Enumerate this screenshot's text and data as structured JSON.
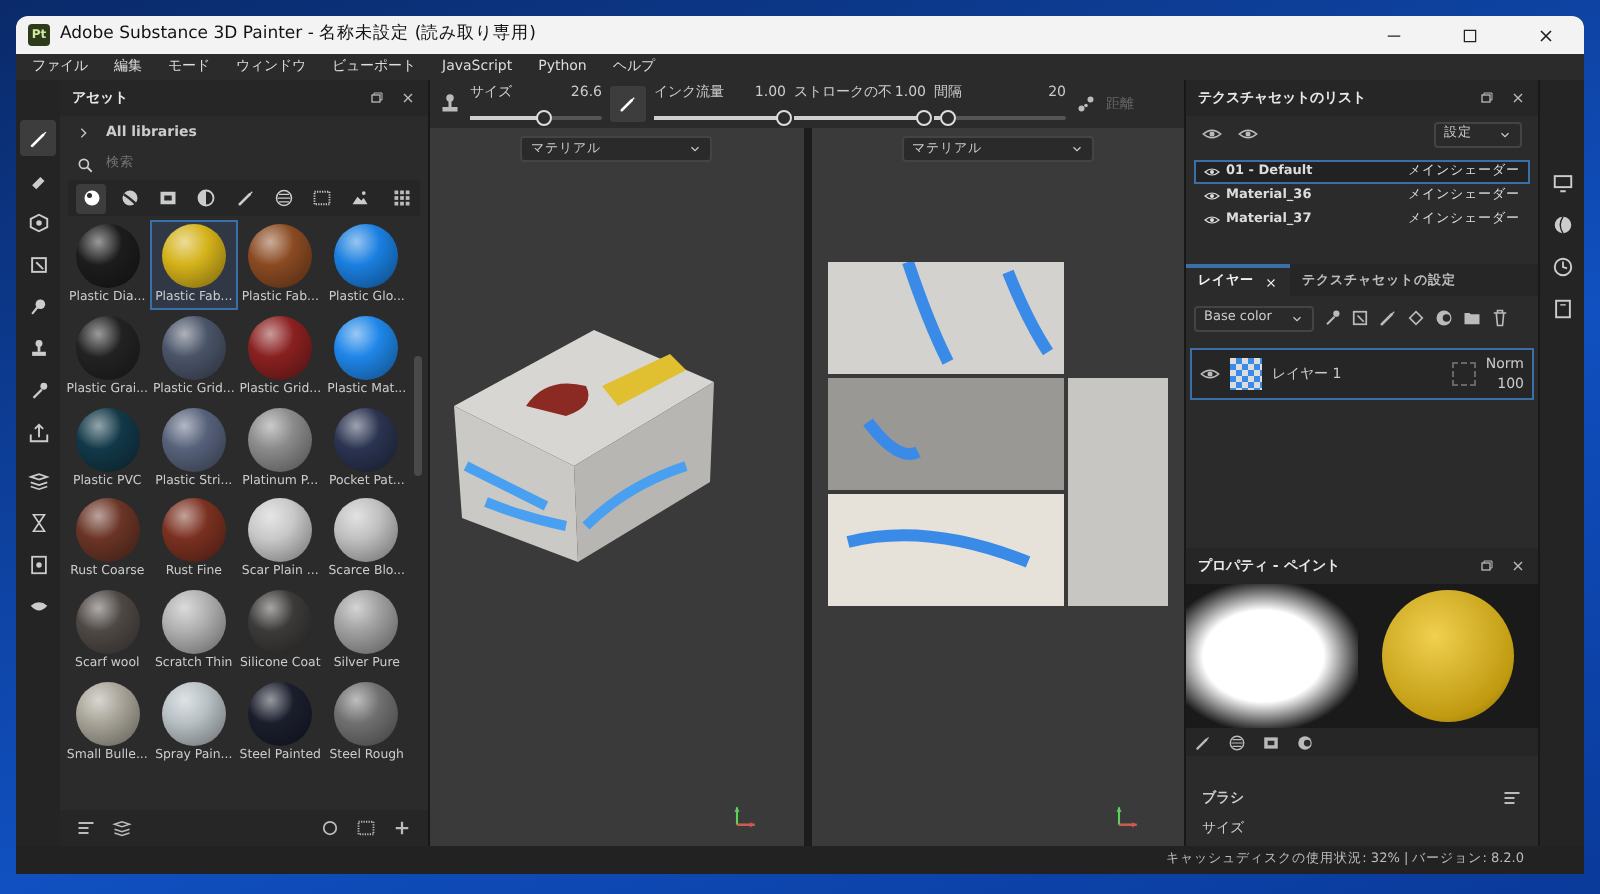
{
  "window": {
    "title": "Adobe Substance 3D Painter - 名称未設定 (読み取り専用)",
    "app_icon": "Pt"
  },
  "menu": [
    "ファイル",
    "編集",
    "モード",
    "ウィンドウ",
    "ビューポート",
    "JavaScript",
    "Python",
    "ヘルプ"
  ],
  "tools": [
    {
      "selected": true
    },
    {
      "selected": false
    },
    {
      "selected": false
    },
    {
      "selected": false
    },
    {
      "selected": false
    },
    {
      "selected": false
    },
    {
      "selected": false
    },
    {
      "selected": false
    },
    {
      "selected": false
    },
    {
      "selected": false
    },
    {
      "selected": false
    },
    {
      "selected": false
    }
  ],
  "assets": {
    "title": "アセット",
    "library": "All libraries",
    "search": {
      "placeholder": "検索"
    },
    "filters": [
      {
        "selected": true
      },
      {
        "selected": false
      },
      {
        "selected": false
      },
      {
        "selected": false
      },
      {
        "selected": false
      },
      {
        "selected": false
      },
      {
        "selected": false
      },
      {
        "selected": false
      }
    ],
    "materials": [
      {
        "label": "Plastic Dia...",
        "color": "#1c1c1c",
        "selected": false
      },
      {
        "label": "Plastic Fab...",
        "color": "#d4b21a",
        "selected": true
      },
      {
        "label": "Plastic Fab...",
        "color": "#8a4a22",
        "selected": false
      },
      {
        "label": "Plastic Glo...",
        "color": "#1a7fe0",
        "selected": false
      },
      {
        "label": "Plastic Grai...",
        "color": "#222222",
        "selected": false
      },
      {
        "label": "Plastic Grid...",
        "color": "#4a5468",
        "selected": false
      },
      {
        "label": "Plastic Grid...",
        "color": "#8a2020",
        "selected": false
      },
      {
        "label": "Plastic Mat...",
        "color": "#1e86e8",
        "selected": false
      },
      {
        "label": "Plastic PVC",
        "color": "#123848",
        "selected": false
      },
      {
        "label": "Plastic Stri...",
        "color": "#56617a",
        "selected": false
      },
      {
        "label": "Platinum P...",
        "color": "#8a8a8a",
        "selected": false
      },
      {
        "label": "Pocket Pat...",
        "color": "#2a3350",
        "selected": false
      },
      {
        "label": "Rust Coarse",
        "color": "#6a3426",
        "selected": false
      },
      {
        "label": "Rust Fine",
        "color": "#7a3020",
        "selected": false
      },
      {
        "label": "Scar Plain ...",
        "color": "#c8c8c8",
        "selected": false
      },
      {
        "label": "Scarce Blo...",
        "color": "#c0c0c0",
        "selected": false
      },
      {
        "label": "Scarf wool",
        "color": "#4e4844",
        "selected": false
      },
      {
        "label": "Scratch Thin",
        "color": "#b0b0b0",
        "selected": false
      },
      {
        "label": "Silicone Coat",
        "color": "#3c3a38",
        "selected": false
      },
      {
        "label": "Silver Pure",
        "color": "#a0a0a0",
        "selected": false
      },
      {
        "label": "Small Bulle...",
        "color": "#a8a498",
        "selected": false
      },
      {
        "label": "Spray Pain...",
        "color": "#b8c0c4",
        "selected": false
      },
      {
        "label": "Steel Painted",
        "color": "#1a1e2c",
        "selected": false
      },
      {
        "label": "Steel Rough",
        "color": "#707070",
        "selected": false
      }
    ]
  },
  "toolbar": {
    "sliders": [
      {
        "label": "サイズ",
        "reading": "26.6",
        "level": 0.55
      },
      {
        "label": "インク流量",
        "reading": "1.00",
        "level": 1
      },
      {
        "label": "ストロークの不",
        "reading": "1.00",
        "level": 1
      },
      {
        "label": "間隔",
        "reading": "20",
        "level": 0.05
      }
    ],
    "distance": {
      "label": "距離",
      "disabled": true
    }
  },
  "viewports": [
    {
      "dropdown": "マテリアル",
      "kind": "model"
    },
    {
      "dropdown": "マテリアル",
      "kind": "uv"
    }
  ],
  "texture_sets": {
    "title": "テクスチャセットのリスト",
    "settings": "設定",
    "items": [
      {
        "name": "01 - Default",
        "shader": "メインシェーダー",
        "selected": true
      },
      {
        "name": "Material_36",
        "shader": "メインシェーダー",
        "selected": false
      },
      {
        "name": "Material_37",
        "shader": "メインシェーダー",
        "selected": false
      }
    ]
  },
  "layer_tabs": [
    {
      "label": "レイヤー",
      "selected": true,
      "closable": true
    },
    {
      "label": "テクスチャセットの設定",
      "selected": false,
      "closable": false
    }
  ],
  "layers": {
    "channel": "Base color",
    "items": [
      {
        "name": "レイヤー 1",
        "blend": "Norm",
        "opacity": "100",
        "visible": true,
        "selected": true
      }
    ]
  },
  "properties": {
    "title": "プロパティ - ペイント",
    "section": "ブラシ",
    "field": "サイズ"
  },
  "status_bar": "キャッシュディスクの使用状況: 32% | バージョン: 8.2.0"
}
